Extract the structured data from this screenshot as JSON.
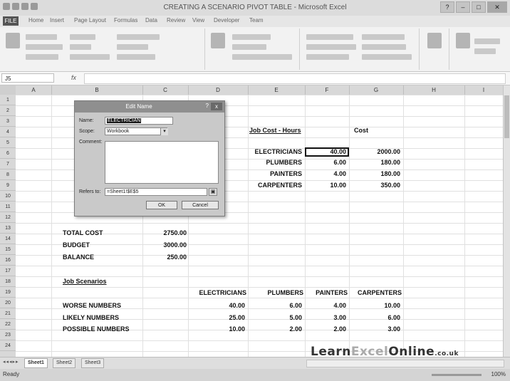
{
  "window": {
    "title": "CREATING A SCENARIO PIVOT TABLE - Microsoft Excel"
  },
  "ribbon_tabs": [
    "FILE",
    "Home",
    "Insert",
    "Page Layout",
    "Formulas",
    "Data",
    "Review",
    "View",
    "Developer",
    "Team"
  ],
  "formula_bar": {
    "name_box": "J5",
    "fx": "fx"
  },
  "columns": [
    "A",
    "B",
    "C",
    "D",
    "E",
    "F",
    "G",
    "H",
    "I"
  ],
  "rows": [
    "1",
    "2",
    "3",
    "4",
    "5",
    "6",
    "7",
    "8",
    "9",
    "10",
    "11",
    "12",
    "13",
    "14",
    "15",
    "16",
    "17",
    "18",
    "19",
    "20",
    "21",
    "22",
    "23",
    "24"
  ],
  "sheet": {
    "section1_title": "Job Cost - Hours",
    "cost_header": "Cost",
    "trades": [
      {
        "name": "ELECTRICIANS",
        "hours": "40.00",
        "cost": "2000.00"
      },
      {
        "name": "PLUMBERS",
        "hours": "6.00",
        "cost": "180.00"
      },
      {
        "name": "PAINTERS",
        "hours": "4.00",
        "cost": "180.00"
      },
      {
        "name": "CARPENTERS",
        "hours": "10.00",
        "cost": "350.00"
      }
    ],
    "totals": [
      {
        "label": "TOTAL COST",
        "value": "2750.00"
      },
      {
        "label": "BUDGET",
        "value": "3000.00"
      },
      {
        "label": "BALANCE",
        "value": "250.00"
      }
    ],
    "section2_title": "Job Scenarios",
    "scenario_headers": [
      "ELECTRICIANS",
      "PLUMBERS",
      "PAINTERS",
      "CARPENTERS"
    ],
    "scenarios": [
      {
        "name": "WORSE NUMBERS",
        "vals": [
          "40.00",
          "6.00",
          "4.00",
          "10.00"
        ]
      },
      {
        "name": "LIKELY NUMBERS",
        "vals": [
          "25.00",
          "5.00",
          "3.00",
          "6.00"
        ]
      },
      {
        "name": "POSSIBLE NUMBERS",
        "vals": [
          "10.00",
          "2.00",
          "2.00",
          "3.00"
        ]
      }
    ]
  },
  "dialog": {
    "title": "Edit Name",
    "help": "?",
    "close": "x",
    "name_label": "Name:",
    "name_value": "ELECTRICIAN",
    "scope_label": "Scope:",
    "scope_value": "Workbook",
    "comment_label": "Comment:",
    "refers_label": "Refers to:",
    "refers_value": "=Sheet1!$E$5",
    "ok": "OK",
    "cancel": "Cancel"
  },
  "sheet_tabs": [
    "Sheet1",
    "Sheet2",
    "Sheet3"
  ],
  "status": {
    "ready": "Ready",
    "zoom": "100%"
  },
  "logo": {
    "part1": "Learn",
    "part2": "Excel",
    "part3": "Online",
    "suffix": ".co.uk"
  },
  "colors": {
    "ribbon": "#f2f2f2",
    "header": "#d8d8d8",
    "grid_line": "#e0e0e0"
  }
}
